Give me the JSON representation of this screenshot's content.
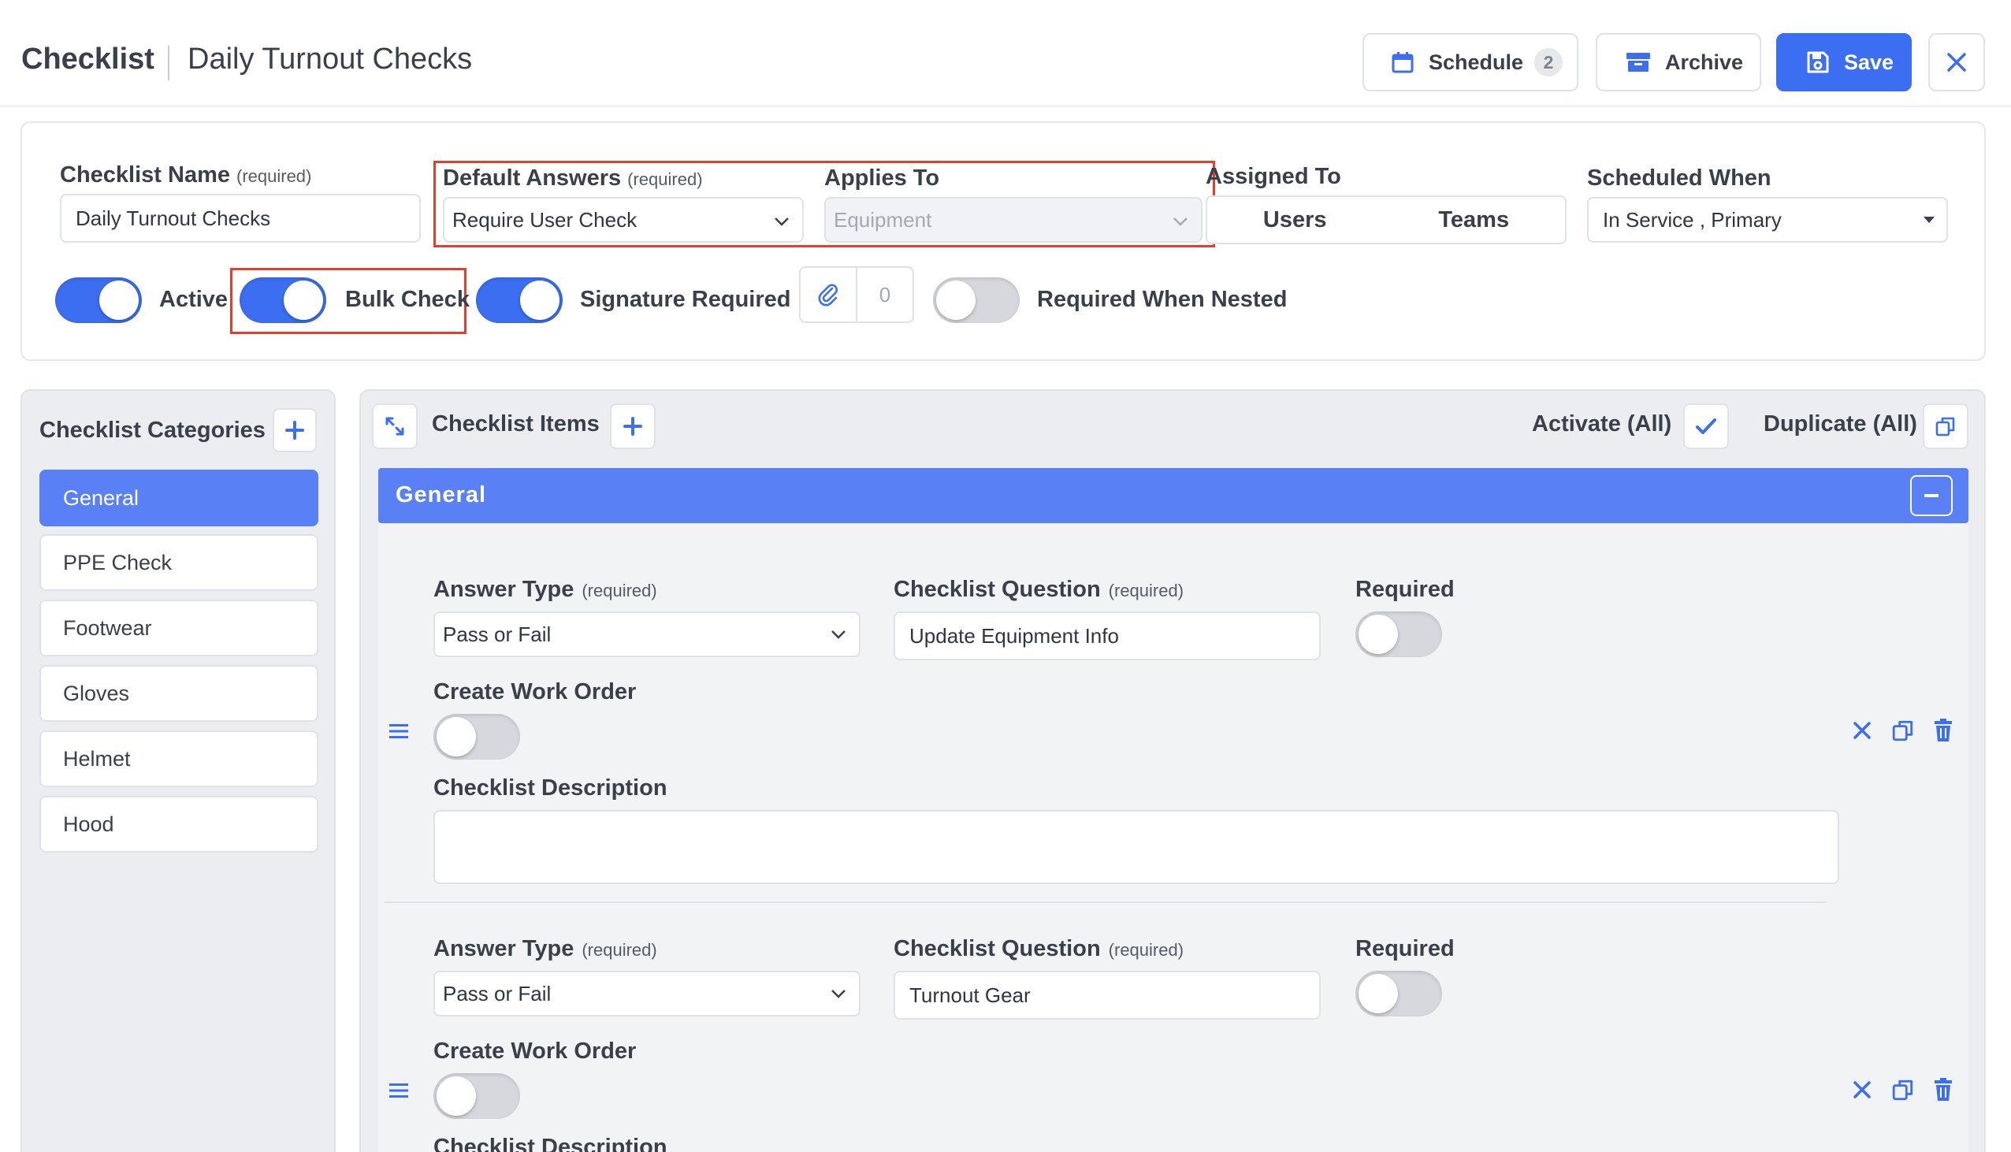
{
  "header": {
    "title": "Checklist",
    "subtitle": "Daily Turnout Checks",
    "schedule_label": "Schedule",
    "schedule_count": "2",
    "archive_label": "Archive",
    "save_label": "Save"
  },
  "settings": {
    "checklist_name": {
      "label": "Checklist Name",
      "required": "(required)",
      "value": "Daily Turnout Checks"
    },
    "default_answers": {
      "label": "Default Answers",
      "required": "(required)",
      "value": "Require User Check"
    },
    "applies_to": {
      "label": "Applies To",
      "value": "Equipment"
    },
    "assigned_to": {
      "label": "Assigned To",
      "users": "Users",
      "teams": "Teams"
    },
    "scheduled_when": {
      "label": "Scheduled When",
      "value": "In Service , Primary"
    },
    "toggles": {
      "active": {
        "label": "Active",
        "on": true
      },
      "bulk_check": {
        "label": "Bulk Check",
        "on": true
      },
      "signature_required": {
        "label": "Signature Required",
        "on": true
      },
      "required_when_nested": {
        "label": "Required When Nested",
        "on": false
      }
    },
    "attachments_count": "0"
  },
  "categories": {
    "title": "Checklist Categories",
    "items": [
      "General",
      "PPE Check",
      "Footwear",
      "Gloves",
      "Helmet",
      "Hood"
    ],
    "active_index": 0
  },
  "items_panel": {
    "title": "Checklist Items",
    "activate_all": "Activate (All)",
    "duplicate_all": "Duplicate (All)",
    "group_name": "General",
    "labels": {
      "answer_type": "Answer Type",
      "checklist_question": "Checklist Question",
      "required_hint": "(required)",
      "required": "Required",
      "create_work_order": "Create Work Order",
      "checklist_description": "Checklist Description"
    },
    "rows": [
      {
        "answer_type": "Pass or Fail",
        "question": "Update Equipment Info",
        "required": false,
        "create_work_order": false,
        "description": ""
      },
      {
        "answer_type": "Pass or Fail",
        "question": "Turnout Gear",
        "required": false,
        "create_work_order": false,
        "description": ""
      }
    ]
  },
  "colors": {
    "accent": "#3b6ef0",
    "group_bar": "#5a80f5",
    "highlight_box": "#e0412f"
  },
  "icons": [
    "calendar-icon",
    "archive-box-icon",
    "floppy-disk-icon",
    "close-icon",
    "paperclip-icon",
    "plus-icon",
    "expand-icon",
    "checkmark-icon",
    "duplicate-icon",
    "minus-icon",
    "drag-handle-icon",
    "remove-x-icon",
    "trash-icon",
    "chevron-down-icon"
  ]
}
